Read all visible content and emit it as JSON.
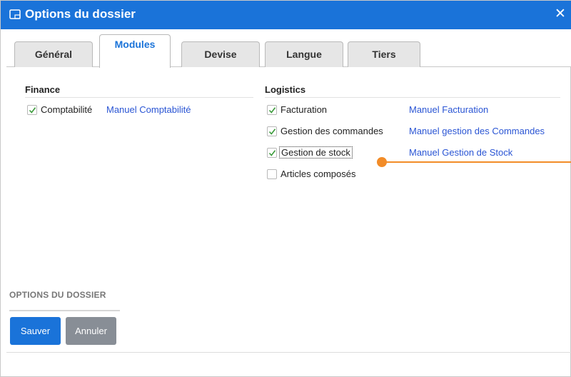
{
  "window": {
    "title": "Options du dossier",
    "icons": {
      "title": "window-icon",
      "close": "close-icon"
    },
    "accent_color": "#1a73d9"
  },
  "tabs": [
    {
      "label": "Général",
      "active": false
    },
    {
      "label": "Modules",
      "active": true
    },
    {
      "label": "Devise",
      "active": false
    },
    {
      "label": "Langue",
      "active": false
    },
    {
      "label": "Tiers",
      "active": false
    }
  ],
  "finance": {
    "title": "Finance",
    "items": [
      {
        "label": "Comptabilité",
        "checked": true,
        "link": "Manuel Comptabilité"
      }
    ]
  },
  "logistics": {
    "title": "Logistics",
    "items": [
      {
        "label": "Facturation",
        "checked": true,
        "link": "Manuel Facturation"
      },
      {
        "label": "Gestion des commandes",
        "checked": true,
        "link": "Manuel gestion des Commandes"
      },
      {
        "label": "Gestion de stock",
        "checked": true,
        "link": "Manuel Gestion de Stock"
      },
      {
        "label": "Articles composés",
        "checked": false,
        "link": ""
      }
    ]
  },
  "footer": {
    "section_title": "OPTIONS DU DOSSIER",
    "save_label": "Sauver",
    "cancel_label": "Annuler"
  },
  "annotation_color": "#f28c28"
}
